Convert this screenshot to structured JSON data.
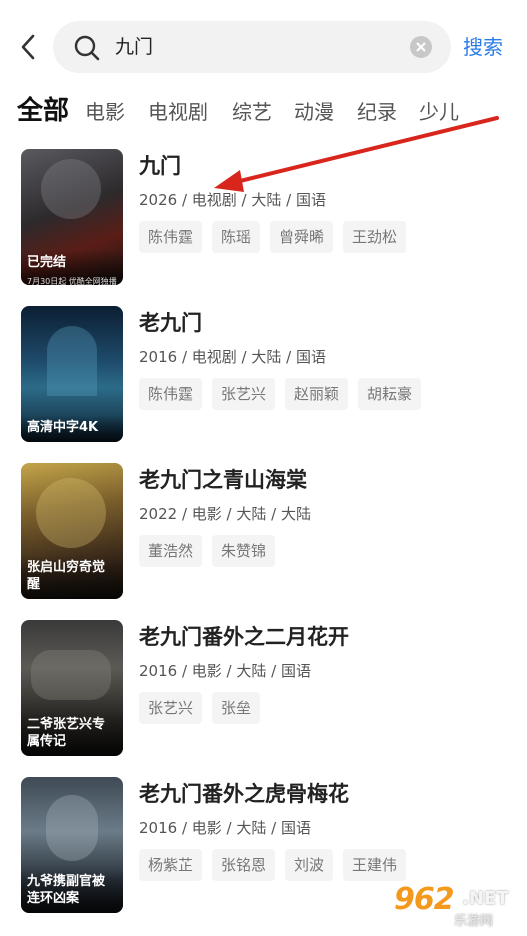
{
  "header": {
    "back_icon": "chevron-left-icon",
    "search_value": "九门",
    "search_icon": "search-icon",
    "clear_icon": "clear-icon",
    "search_button": "搜索"
  },
  "tabs": [
    "全部",
    "电影",
    "电视剧",
    "综艺",
    "动漫",
    "纪录",
    "少儿"
  ],
  "active_tab": "全部",
  "results": [
    {
      "title": "九门",
      "meta": "2026 / 电视剧 / 大陆 / 国语",
      "badge": "已完结",
      "badge_sub": "7月30日起 优酷全网独播",
      "cast": [
        "陈伟霆",
        "陈瑶",
        "曾舜晞",
        "王劲松"
      ]
    },
    {
      "title": "老九门",
      "meta": "2016 / 电视剧 / 大陆 / 国语",
      "badge": "高清中字4K",
      "cast": [
        "陈伟霆",
        "张艺兴",
        "赵丽颖",
        "胡耘豪"
      ]
    },
    {
      "title": "老九门之青山海棠",
      "meta": "2022 / 电影 / 大陆 / 大陆",
      "badge": "张启山穷奇觉醒",
      "cast": [
        "董浩然",
        "朱赞锦"
      ]
    },
    {
      "title": "老九门番外之二月花开",
      "meta": "2016 / 电影 / 大陆 / 国语",
      "badge": "二爷张艺兴专属传记",
      "cast": [
        "张艺兴",
        "张垒"
      ]
    },
    {
      "title": "老九门番外之虎骨梅花",
      "meta": "2016 / 电影 / 大陆 / 国语",
      "badge": "九爷携副官被连环凶案",
      "cast": [
        "杨紫芷",
        "张铭恩",
        "刘波",
        "王建伟"
      ]
    }
  ],
  "annotation_arrow_color": "#d9261c",
  "watermark": {
    "number": "962",
    "suffix": ".NET",
    "cn": "乐游网"
  },
  "colors": {
    "accent": "#2a7de8",
    "watermark": "#f39a1e"
  }
}
